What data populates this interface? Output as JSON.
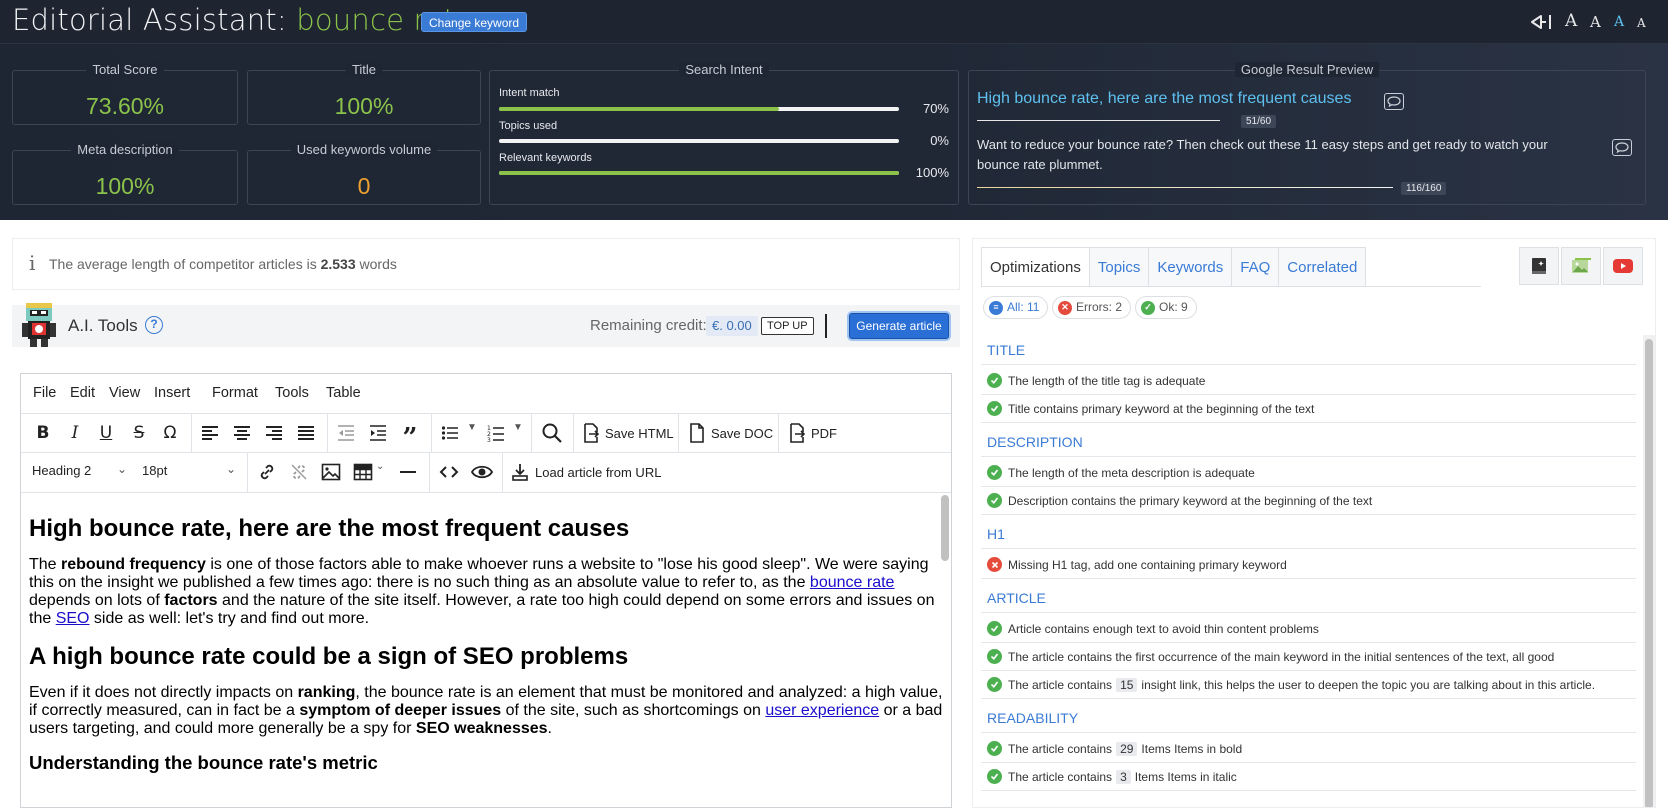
{
  "header": {
    "title_prefix": "Editorial Assistant: ",
    "keyword": "bounce rate",
    "change_keyword_label": "Change keyword",
    "font_sizes": [
      "A",
      "A",
      "A",
      "A"
    ]
  },
  "stats": {
    "total_score": {
      "label": "Total Score",
      "value": "73.60%"
    },
    "title": {
      "label": "Title",
      "value": "100%"
    },
    "meta_description": {
      "label": "Meta description",
      "value": "100%"
    },
    "used_keywords_volume": {
      "label": "Used keywords volume",
      "value": "0"
    },
    "search_intent": {
      "label": "Search Intent",
      "bars": [
        {
          "label": "Intent match",
          "percent": 70,
          "text": "70%"
        },
        {
          "label": "Topics used",
          "percent": 0,
          "text": "0%"
        },
        {
          "label": "Relevant keywords",
          "percent": 100,
          "text": "100%"
        }
      ]
    },
    "google_preview": {
      "label": "Google Result Preview",
      "title": "High bounce rate, here are the most frequent causes",
      "title_count": "51/60",
      "description": "Want to reduce your bounce rate? Then check out these 11 easy steps and get ready to watch your bounce rate plummet.",
      "description_count": "116/160"
    }
  },
  "info": {
    "icon": "info-icon",
    "text_prefix": "The average length of competitor articles is ",
    "words_value": "2.533",
    "text_suffix": " words"
  },
  "ai_tools": {
    "title": "A.I. Tools",
    "help": "?",
    "credit_label": "Remaining credit:",
    "credit_value": "€. 0.00",
    "topup_label": "TOP UP",
    "generate_label": "Generate article"
  },
  "editor": {
    "menu": [
      "File",
      "Edit",
      "View",
      "Insert",
      "Format",
      "Tools",
      "Table"
    ],
    "toolbar": {
      "save_html": "Save HTML",
      "save_doc": "Save DOC",
      "pdf": "PDF",
      "block_format": "Heading 2",
      "font_size": "18pt",
      "load_url": "Load article from URL"
    },
    "content": {
      "h1": "High bounce rate, here are the most frequent causes",
      "p1": {
        "a": "The ",
        "b1": "rebound frequency",
        "c": " is one of those factors able to make whoever runs a website to \"lose his good sleep\". We were saying this on the insight we published a few times ago: there is no such thing as an absolute value to refer to, as the ",
        "link1": "bounce rate",
        "d": " depends on lots of ",
        "b2": "factors",
        "e": " and the nature of the site itself. However, a rate too high could depend on some errors and issues on the ",
        "link2": "SEO",
        "f": " side as well: let's try and find out more."
      },
      "h2": "A high bounce rate could be a sign of SEO problems",
      "p2": {
        "a": "Even if it does not directly impacts on ",
        "b1": "ranking",
        "c": ", the bounce rate is an element that must be monitored and analyzed: a high value, if correctly measured, can in fact be a ",
        "b2": "symptom of deeper issues",
        "d": " of the site, such as shortcomings on ",
        "link1": "user experience",
        "e": " or a bad users targeting, and could more generally be a spy for ",
        "b3": "SEO weaknesses",
        "f": "."
      },
      "h3": "Understanding the bounce rate's metric"
    }
  },
  "right_panel": {
    "tabs": [
      "Optimizations",
      "Topics",
      "Keywords",
      "FAQ",
      "Correlated"
    ],
    "filters": {
      "all": "All: 11",
      "errors": "Errors: 2",
      "ok": "Ok: 9"
    },
    "sections": [
      {
        "title": "TITLE",
        "items": [
          {
            "status": "ok",
            "text": "The length of the title tag is adequate"
          },
          {
            "status": "ok",
            "text": "Title contains primary keyword at the beginning of the text"
          }
        ]
      },
      {
        "title": "DESCRIPTION",
        "items": [
          {
            "status": "ok",
            "text": "The length of the meta description is adequate"
          },
          {
            "status": "ok",
            "text": "Description contains the primary keyword at the beginning of the text"
          }
        ]
      },
      {
        "title": "H1",
        "items": [
          {
            "status": "error",
            "text": "Missing H1 tag, add one containing primary keyword"
          }
        ]
      },
      {
        "title": "ARTICLE",
        "items": [
          {
            "status": "ok",
            "text": "Article contains enough text to avoid thin content problems"
          },
          {
            "status": "ok",
            "text": "The article contains the first occurrence of the main keyword in the initial sentences of the text, all good"
          },
          {
            "status": "ok",
            "pre": "The article contains",
            "num": "15",
            "post": "insight link, this helps the user to deepen the topic you are talking about in this article."
          }
        ]
      },
      {
        "title": "READABILITY",
        "items": [
          {
            "status": "ok",
            "pre": "The article contains",
            "num": "29",
            "post": "Items Items in bold"
          },
          {
            "status": "ok",
            "pre": "The article contains",
            "num": "3",
            "post": "Items Items in italic"
          }
        ]
      }
    ]
  },
  "colors": {
    "header_bg": "#1e2430",
    "accent_green": "#8bc34a",
    "accent_orange": "#f0a030",
    "link_blue": "#3a7bd5",
    "preview_title": "#5ec0ef"
  }
}
